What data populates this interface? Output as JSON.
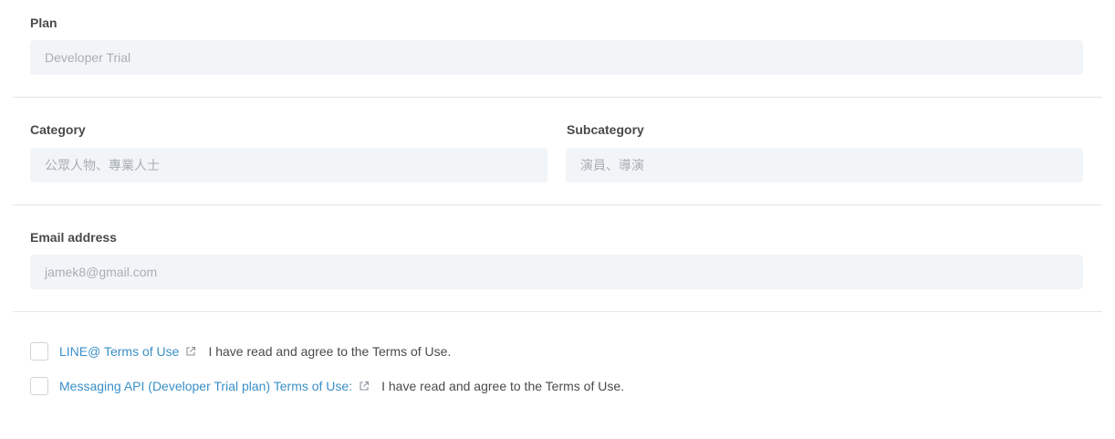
{
  "plan": {
    "label": "Plan",
    "value": "Developer Trial"
  },
  "category": {
    "label": "Category",
    "value": "公眾人物、專業人士"
  },
  "subcategory": {
    "label": "Subcategory",
    "value": "演員、導演"
  },
  "email": {
    "label": "Email address",
    "value": "jamek8@gmail.com"
  },
  "terms": [
    {
      "link": "LINE@ Terms of Use",
      "agree": "I have read and agree to the Terms of Use.",
      "checked": false
    },
    {
      "link": "Messaging API (Developer Trial plan) Terms of Use:",
      "agree": "I have read and agree to the Terms of Use.",
      "checked": false
    }
  ],
  "colors": {
    "link": "#3a8fc7",
    "field_bg": "#f2f5f8",
    "divider": "#e3e6ea"
  }
}
